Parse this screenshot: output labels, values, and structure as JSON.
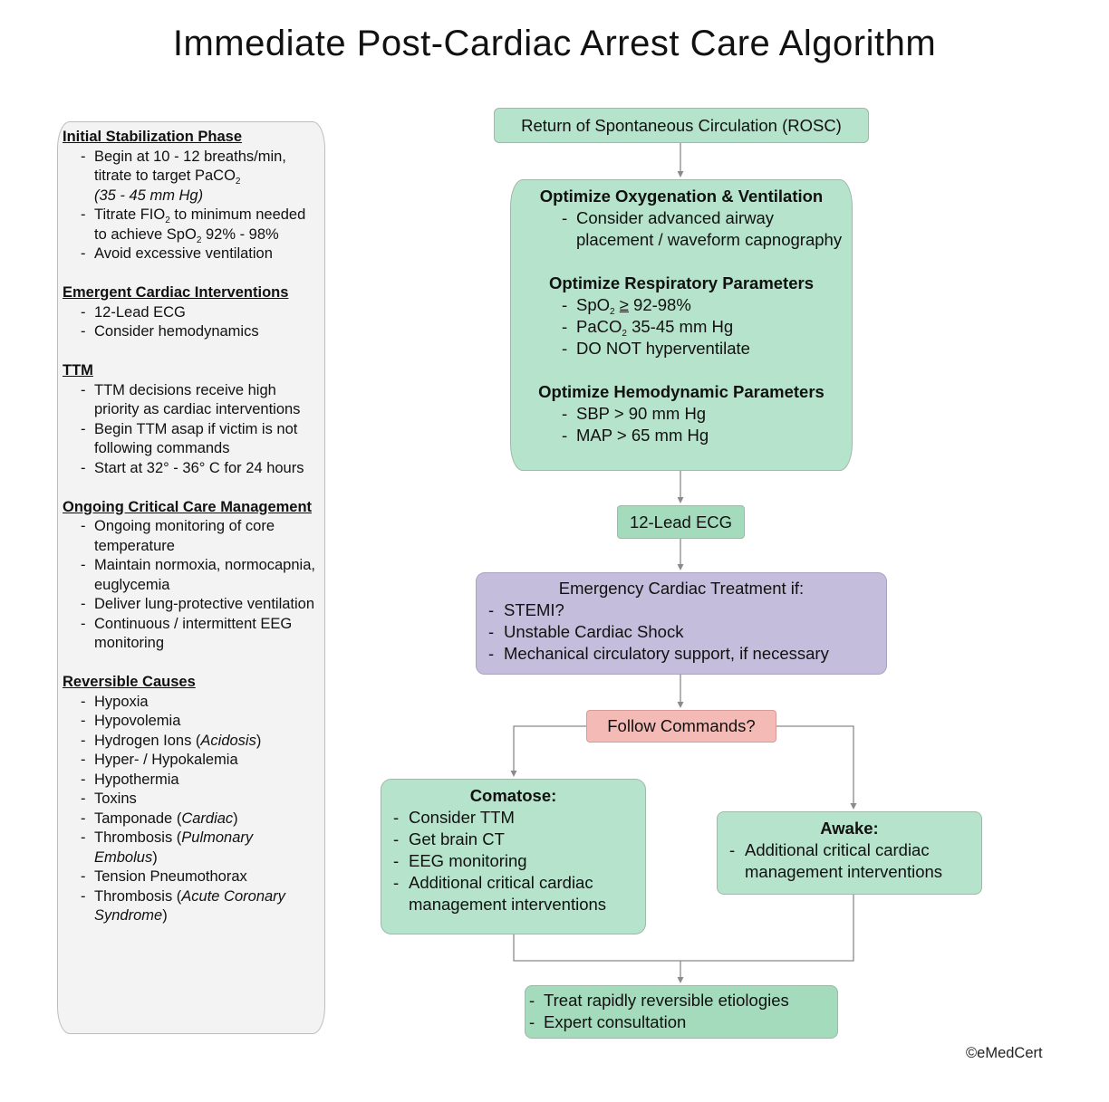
{
  "title": "Immediate Post-Cardiac Arrest Care Algorithm",
  "sidebar": {
    "sections": [
      {
        "heading": "Initial Stabilization Phase",
        "items": [
          {
            "pre": "Begin at 10 - 12 breaths/min, titrate to target PaCO",
            "sub": "2",
            "italic": "(35 - 45 mm Hg)"
          },
          {
            "pre": "Titrate FIO",
            "sub": "2",
            "mid": " to minimum needed to achieve SpO",
            "sub2": "2",
            "post": " 92% - 98%"
          },
          {
            "pre": "Avoid excessive ventilation"
          }
        ]
      },
      {
        "heading": "Emergent Cardiac Interventions",
        "items": [
          "12-Lead ECG",
          "Consider hemodynamics"
        ]
      },
      {
        "heading": "TTM",
        "items": [
          "TTM decisions receive high priority as cardiac interventions",
          "Begin TTM asap if victim is not following commands",
          "Start at 32° - 36° C for 24 hours"
        ]
      },
      {
        "heading": "Ongoing Critical Care Management",
        "items": [
          "Ongoing monitoring of core temperature",
          "Maintain normoxia, normocapnia, euglycemia",
          "Deliver lung-protective ventilation",
          "Continuous / intermittent EEG monitoring"
        ]
      },
      {
        "heading": "Reversible Causes",
        "items": [
          {
            "text": "Hypoxia"
          },
          {
            "text": "Hypovolemia"
          },
          {
            "text": "Hydrogen Ions (",
            "italic": "Acidosis",
            "post": ")"
          },
          {
            "text": "Hyper- / Hypokalemia"
          },
          {
            "text": "Hypothermia"
          },
          {
            "text": "Toxins"
          },
          {
            "text": "Tamponade (",
            "italic": "Cardiac",
            "post": ")"
          },
          {
            "text": "Thrombosis (",
            "italic": "Pulmonary Embolus",
            "post": ")"
          },
          {
            "text": "Tension Pneumothorax"
          },
          {
            "text": "Thrombosis (",
            "italic": "Acute Coronary Syndrome",
            "post": ")"
          }
        ]
      }
    ]
  },
  "flow": {
    "rosc": "Return of Spontaneous Circulation (ROSC)",
    "optimize": {
      "oxy_heading": "Optimize Oxygenation & Ventilation",
      "oxy_items": [
        "Consider advanced airway placement / waveform capnography"
      ],
      "resp_heading": "Optimize Respiratory Parameters",
      "resp_items": [
        {
          "pre": "SpO",
          "sub": "2",
          "op": "≥",
          "post": " 92-98%"
        },
        {
          "pre": "PaCO",
          "sub": "2",
          "post": " 35-45 mm Hg"
        },
        {
          "pre": "DO NOT hyperventilate"
        }
      ],
      "hemo_heading": "Optimize Hemodynamic Parameters",
      "hemo_items": [
        "SBP > 90 mm Hg",
        "MAP > 65 mm Hg"
      ]
    },
    "ecg": "12-Lead ECG",
    "emergency": {
      "heading": "Emergency Cardiac Treatment if:",
      "items": [
        "STEMI?",
        "Unstable Cardiac Shock",
        "Mechanical circulatory support, if necessary"
      ]
    },
    "decision": "Follow Commands?",
    "comatose": {
      "heading": "Comatose:",
      "items": [
        "Consider TTM",
        "Get brain CT",
        "EEG monitoring",
        "Additional critical cardiac management interventions"
      ]
    },
    "awake": {
      "heading": "Awake:",
      "items": [
        "Additional critical cardiac management interventions"
      ]
    },
    "final": {
      "items": [
        "Treat rapidly reversible etiologies",
        "Expert consultation"
      ]
    }
  },
  "copyright": "©eMedCert",
  "colors": {
    "green_box": "#b6e3cb",
    "green_final": "#a3dbbc",
    "purple_box": "#c5bddc",
    "red_decision": "#f4bab6",
    "sidebar_bg": "#f3f3f3",
    "connector": "#8a8a8a"
  }
}
